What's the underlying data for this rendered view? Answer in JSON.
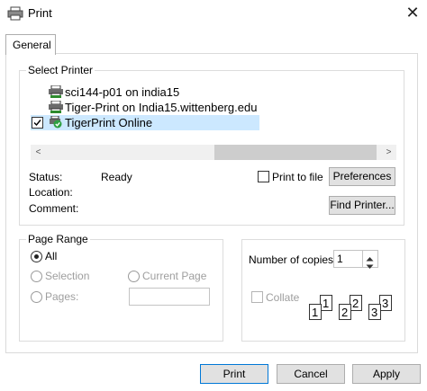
{
  "window": {
    "title": "Print",
    "close_glyph": "✕"
  },
  "tabs": [
    {
      "label": "General"
    }
  ],
  "select_printer": {
    "legend": "Select Printer",
    "printers": [
      {
        "name": "sci144-p01 on india15",
        "icon": "printer-icon"
      },
      {
        "name": "Tiger-Print on India15.wittenberg.edu",
        "icon": "printer-icon"
      },
      {
        "name": "TigerPrint Online",
        "icon": "default-printer-icon",
        "selected": true,
        "checked": true
      }
    ],
    "scroll_left": "<",
    "scroll_right": ">"
  },
  "status": {
    "status_label": "Status:",
    "status_value": "Ready",
    "location_label": "Location:",
    "location_value": "",
    "comment_label": "Comment:",
    "comment_value": ""
  },
  "print_to_file": {
    "label": "Print to file",
    "checked": false
  },
  "buttons": {
    "preferences": "Preferences",
    "find_printer": "Find Printer...",
    "print": "Print",
    "cancel": "Cancel",
    "apply": "Apply"
  },
  "page_range": {
    "legend": "Page Range",
    "all": "All",
    "selection": "Selection",
    "current_page": "Current Page",
    "pages": "Pages:",
    "selected_option": "All"
  },
  "copies": {
    "label": "Number of copies:",
    "value": "1",
    "collate_label": "Collate",
    "collate_checked": false,
    "illustration": [
      "1",
      "1",
      "2",
      "2",
      "3",
      "3"
    ]
  },
  "colors": {
    "accent": "#0078d7",
    "selection": "#cce8ff",
    "disabled": "#9e9e9e"
  }
}
